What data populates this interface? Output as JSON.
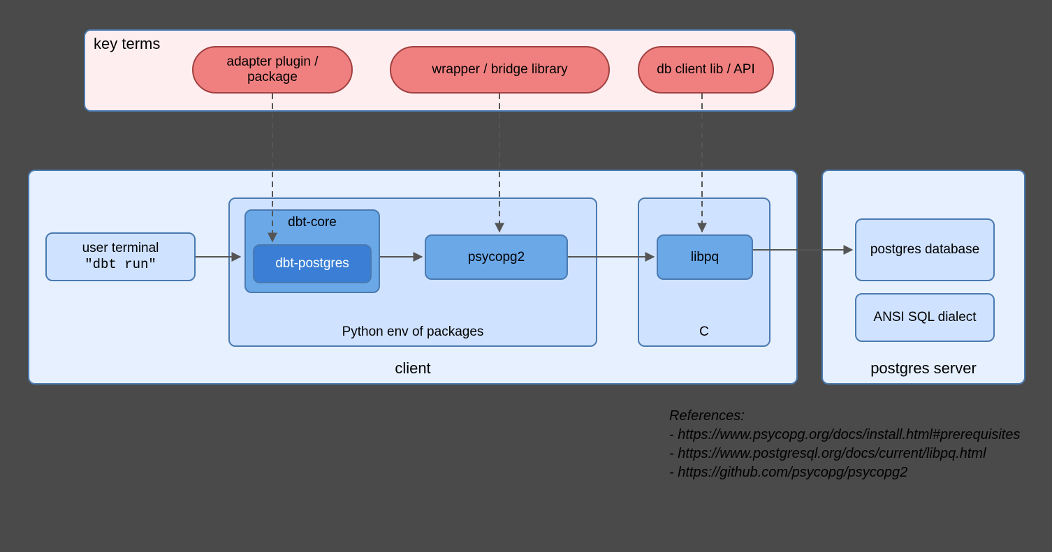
{
  "keyTerms": {
    "title": "key terms",
    "pill1": "adapter plugin / package",
    "pill2": "wrapper / bridge library",
    "pill3": "db client lib / API"
  },
  "client": {
    "label": "client",
    "terminal_line1": "user terminal",
    "terminal_line2": "\"dbt run\"",
    "pythonEnv": {
      "label": "Python env of packages",
      "dbtcore": "dbt-core",
      "dbtpostgres": "dbt-postgres",
      "psycopg2": "psycopg2"
    },
    "cEnv": {
      "label": "C",
      "libpq": "libpq"
    }
  },
  "server": {
    "label": "postgres server",
    "db": "postgres database",
    "dialect": "ANSI SQL dialect"
  },
  "references": {
    "title": "References:",
    "r1": "- https://www.psycopg.org/docs/install.html#prerequisites",
    "r2": "- https://www.postgresql.org/docs/current/libpq.html",
    "r3": "- https://github.com/psycopg/psycopg2"
  }
}
